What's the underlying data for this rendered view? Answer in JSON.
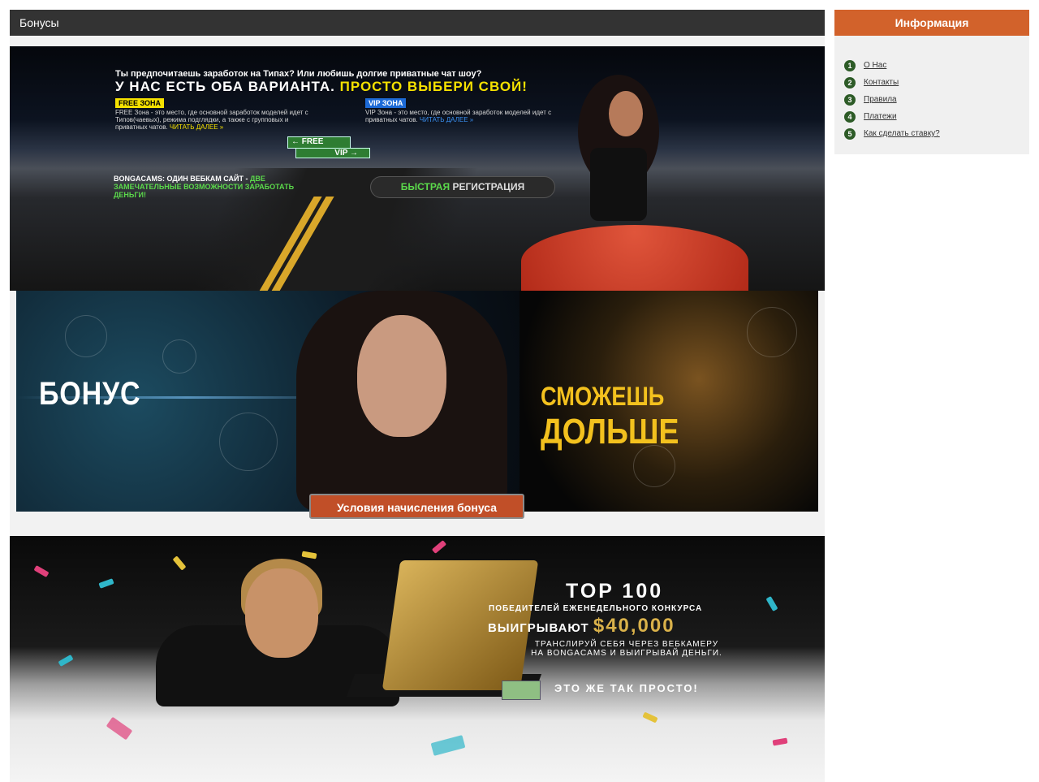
{
  "main": {
    "section_title": "Бонусы"
  },
  "banner1": {
    "question": "Ты предпочитаешь заработок на Типах? Или любишь долгие приватные чат шоу?",
    "headline_white": "У НАС ЕСТЬ ОБА ВАРИАНТА.",
    "headline_yellow": "ПРОСТО ВЫБЕРИ СВОЙ!",
    "free_zone_label": "FREE ЗОНА",
    "free_zone_text": "FREE Зона - это место, где основной заработок моделей идет с Типов(чаевых), режима подглядки, а также с групповых и приватных чатов.",
    "free_zone_more": "ЧИТАТЬ ДАЛЕЕ »",
    "vip_zone_label": "VIP ЗОНА",
    "vip_zone_text": "VIP Зона - это место, где основной заработок моделей идет с приватных чатов.",
    "vip_zone_more": "ЧИТАТЬ ДАЛЕЕ »",
    "sign_free": "FREE",
    "sign_vip": "VIP",
    "one_site_white": "BONGACAMS: ОДИН ВЕБКАМ САЙТ -",
    "one_site_green": "ДВЕ ЗАМЕЧАТЕЛЬНЫЕ ВОЗМОЖНОСТИ ЗАРАБОТАТЬ ДЕНЬГИ!",
    "quick_green": "БЫСТРАЯ",
    "quick_white": "РЕГИСТРАЦИЯ"
  },
  "banner2": {
    "bonus_text": "БОНУС",
    "longer_small": "СМОЖЕШЬ",
    "longer_big": "ДОЛЬШЕ",
    "conditions_button": "Условия начисления бонуса"
  },
  "banner3": {
    "top_text": "TOP 100",
    "winners_text": "ПОБЕДИТЕЛЕЙ ЕЖЕНЕДЕЛЬНОГО КОНКУРСА",
    "win_label": "ВЫИГРЫВАЮТ",
    "amount": "$40,000",
    "translate_text": "ТРАНСЛИРУЙ СЕБЯ ЧЕРЕЗ ВЕБКАМЕРУ НА BONGACAMS И ВЫИГРЫВАЙ ДЕНЬГИ.",
    "easy_text": "ЭТО ЖЕ ТАК ПРОСТО!"
  },
  "sidebar": {
    "title": "Информация",
    "items": [
      {
        "num": "1",
        "label": "О Нас"
      },
      {
        "num": "2",
        "label": "Контакты"
      },
      {
        "num": "3",
        "label": "Правила"
      },
      {
        "num": "4",
        "label": "Платежи"
      },
      {
        "num": "5",
        "label": "Как сделать ставку?"
      }
    ]
  },
  "colors": {
    "header_dark": "#333333",
    "sidebar_accent": "#d2622b",
    "number_badge": "#2d5b27",
    "button_orange": "#c14f28"
  }
}
